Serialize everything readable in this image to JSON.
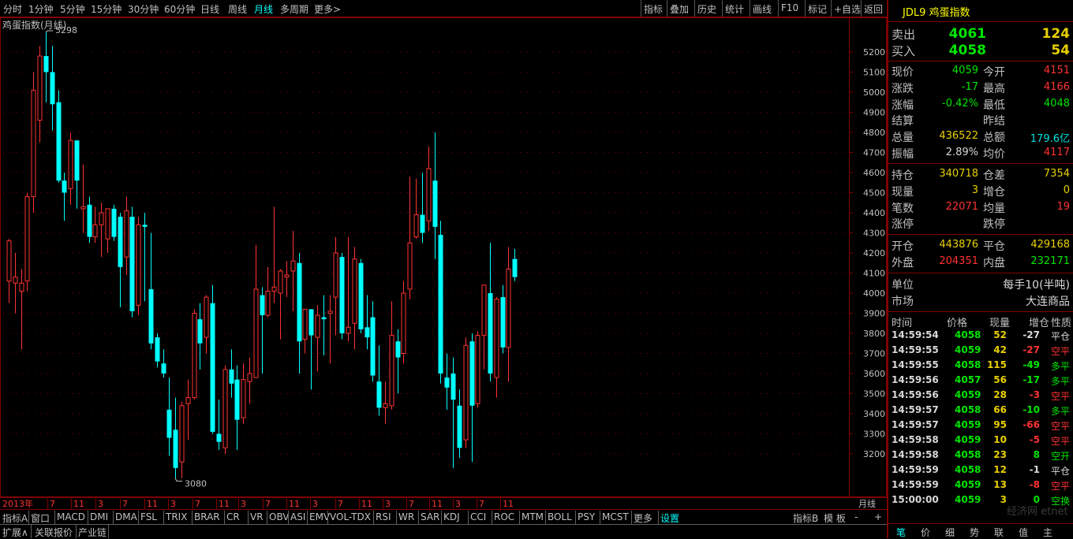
{
  "toolbar": {
    "periods": [
      "分时",
      "1分钟",
      "5分钟",
      "15分钟",
      "30分钟",
      "60分钟",
      "日线",
      "周线",
      "月线",
      "多周期",
      "更多>"
    ],
    "active_period": "月线",
    "right_items": [
      "指标",
      "叠加",
      "历史",
      "统计",
      "画线",
      "F10",
      "标记",
      "+自选",
      "返回"
    ]
  },
  "chart": {
    "title": "鸡蛋指数(月线)",
    "max_label": "5298",
    "min_label": "3080",
    "period_label": "月线",
    "year_label": "2013年",
    "x_ticks": [
      "7",
      "11",
      "3",
      "7",
      "11",
      "3",
      "7",
      "11",
      "3",
      "7",
      "11",
      "3",
      "7",
      "11",
      "3",
      "7",
      "11",
      "3",
      "7",
      "11"
    ],
    "colors": {
      "up": "#ff3232",
      "down": "#00ffff",
      "grid": "#800000",
      "axis_text": "#c0c0c0"
    }
  },
  "chart_data": {
    "type": "candlestick",
    "title": "鸡蛋指数(月线)",
    "y_ticks": [
      3200,
      3300,
      3400,
      3500,
      3600,
      3700,
      3800,
      3900,
      4000,
      4100,
      4200,
      4300,
      4400,
      4500,
      4600,
      4700,
      4800,
      4900,
      5000,
      5100,
      5200
    ],
    "ylim": [
      3080,
      5298
    ],
    "candles": [
      {
        "o": 4060,
        "h": 4270,
        "l": 3950,
        "c": 4260
      },
      {
        "o": 4050,
        "h": 4200,
        "l": 3900,
        "c": 4080
      },
      {
        "o": 4010,
        "h": 4120,
        "l": 3720,
        "c": 4050
      },
      {
        "o": 4060,
        "h": 4500,
        "l": 4010,
        "c": 4480
      },
      {
        "o": 4480,
        "h": 5100,
        "l": 4400,
        "c": 5010
      },
      {
        "o": 4860,
        "h": 5230,
        "l": 4750,
        "c": 5180
      },
      {
        "o": 5180,
        "h": 5298,
        "l": 4950,
        "c": 5100
      },
      {
        "o": 5100,
        "h": 5230,
        "l": 4810,
        "c": 4940
      },
      {
        "o": 4950,
        "h": 5010,
        "l": 4550,
        "c": 4560
      },
      {
        "o": 4560,
        "h": 4600,
        "l": 4360,
        "c": 4500
      },
      {
        "o": 4520,
        "h": 4800,
        "l": 4440,
        "c": 4760
      },
      {
        "o": 4760,
        "h": 4720,
        "l": 4420,
        "c": 4560
      },
      {
        "o": 4420,
        "h": 4640,
        "l": 4300,
        "c": 4430
      },
      {
        "o": 4440,
        "h": 4480,
        "l": 4250,
        "c": 4280
      },
      {
        "o": 4280,
        "h": 4430,
        "l": 4250,
        "c": 4340
      },
      {
        "o": 4340,
        "h": 4450,
        "l": 4180,
        "c": 4400
      },
      {
        "o": 4270,
        "h": 4410,
        "l": 4200,
        "c": 4420
      },
      {
        "o": 4420,
        "h": 4440,
        "l": 4260,
        "c": 4280
      },
      {
        "o": 4380,
        "h": 4400,
        "l": 3930,
        "c": 4130
      },
      {
        "o": 4180,
        "h": 4480,
        "l": 4090,
        "c": 4410
      },
      {
        "o": 4380,
        "h": 4430,
        "l": 3880,
        "c": 3910
      },
      {
        "o": 3940,
        "h": 4380,
        "l": 3890,
        "c": 4340
      },
      {
        "o": 4340,
        "h": 4400,
        "l": 3960,
        "c": 4330
      },
      {
        "o": 4020,
        "h": 4300,
        "l": 3720,
        "c": 3750
      },
      {
        "o": 3780,
        "h": 3800,
        "l": 3630,
        "c": 3660
      },
      {
        "o": 3650,
        "h": 3720,
        "l": 3580,
        "c": 3600
      },
      {
        "o": 3420,
        "h": 3580,
        "l": 3190,
        "c": 3280
      },
      {
        "o": 3320,
        "h": 3480,
        "l": 3080,
        "c": 3130
      },
      {
        "o": 3160,
        "h": 3460,
        "l": 3080,
        "c": 3440
      },
      {
        "o": 3450,
        "h": 3570,
        "l": 3270,
        "c": 3480
      },
      {
        "o": 3480,
        "h": 3920,
        "l": 3470,
        "c": 3900
      },
      {
        "o": 3870,
        "h": 3950,
        "l": 3620,
        "c": 3750
      },
      {
        "o": 3780,
        "h": 3990,
        "l": 3700,
        "c": 3980
      },
      {
        "o": 3950,
        "h": 4040,
        "l": 3300,
        "c": 3310
      },
      {
        "o": 3300,
        "h": 3470,
        "l": 3220,
        "c": 3260
      },
      {
        "o": 3230,
        "h": 3640,
        "l": 3200,
        "c": 3620
      },
      {
        "o": 3620,
        "h": 3720,
        "l": 3480,
        "c": 3550
      },
      {
        "o": 3570,
        "h": 3640,
        "l": 3220,
        "c": 3370
      },
      {
        "o": 3380,
        "h": 3650,
        "l": 3350,
        "c": 3570
      },
      {
        "o": 3560,
        "h": 3680,
        "l": 3450,
        "c": 3600
      },
      {
        "o": 3580,
        "h": 4240,
        "l": 3580,
        "c": 4020
      },
      {
        "o": 3990,
        "h": 4030,
        "l": 3600,
        "c": 3890
      },
      {
        "o": 3890,
        "h": 4130,
        "l": 3880,
        "c": 4010
      },
      {
        "o": 4010,
        "h": 4430,
        "l": 3950,
        "c": 4030
      },
      {
        "o": 4000,
        "h": 4120,
        "l": 3770,
        "c": 4110
      },
      {
        "o": 4080,
        "h": 4160,
        "l": 3980,
        "c": 4090
      },
      {
        "o": 4110,
        "h": 4310,
        "l": 3910,
        "c": 4160
      },
      {
        "o": 4150,
        "h": 4200,
        "l": 3600,
        "c": 3760
      },
      {
        "o": 3770,
        "h": 3900,
        "l": 3700,
        "c": 3920
      },
      {
        "o": 3920,
        "h": 3920,
        "l": 3520,
        "c": 3790
      },
      {
        "o": 3780,
        "h": 3940,
        "l": 3610,
        "c": 3890
      },
      {
        "o": 3880,
        "h": 3990,
        "l": 3690,
        "c": 3870
      },
      {
        "o": 3900,
        "h": 3990,
        "l": 3650,
        "c": 3910
      },
      {
        "o": 3980,
        "h": 4280,
        "l": 3790,
        "c": 4200
      },
      {
        "o": 4180,
        "h": 4200,
        "l": 3770,
        "c": 3800
      },
      {
        "o": 3800,
        "h": 4280,
        "l": 3760,
        "c": 3830
      },
      {
        "o": 3850,
        "h": 4230,
        "l": 3720,
        "c": 4170
      },
      {
        "o": 4150,
        "h": 4170,
        "l": 3800,
        "c": 3820
      },
      {
        "o": 3830,
        "h": 3990,
        "l": 3720,
        "c": 3780
      },
      {
        "o": 3880,
        "h": 3960,
        "l": 3560,
        "c": 3590
      },
      {
        "o": 3560,
        "h": 3740,
        "l": 3390,
        "c": 3430
      },
      {
        "o": 3430,
        "h": 3560,
        "l": 3350,
        "c": 3450
      },
      {
        "o": 3440,
        "h": 3960,
        "l": 3420,
        "c": 3790
      },
      {
        "o": 3760,
        "h": 3820,
        "l": 3500,
        "c": 3680
      },
      {
        "o": 3700,
        "h": 4060,
        "l": 3650,
        "c": 4000
      },
      {
        "o": 4020,
        "h": 4580,
        "l": 3970,
        "c": 4250
      },
      {
        "o": 4280,
        "h": 4570,
        "l": 4270,
        "c": 4390
      },
      {
        "o": 4390,
        "h": 4600,
        "l": 4250,
        "c": 4300
      },
      {
        "o": 4360,
        "h": 4730,
        "l": 4310,
        "c": 4620
      },
      {
        "o": 4560,
        "h": 4800,
        "l": 4170,
        "c": 4330
      },
      {
        "o": 4290,
        "h": 4360,
        "l": 3550,
        "c": 3600
      },
      {
        "o": 3580,
        "h": 3700,
        "l": 3420,
        "c": 3530
      },
      {
        "o": 3600,
        "h": 3680,
        "l": 3130,
        "c": 3470
      },
      {
        "o": 3440,
        "h": 3520,
        "l": 3180,
        "c": 3230
      },
      {
        "o": 3270,
        "h": 3780,
        "l": 3230,
        "c": 3740
      },
      {
        "o": 3760,
        "h": 3800,
        "l": 3160,
        "c": 3440
      },
      {
        "o": 3450,
        "h": 3810,
        "l": 3430,
        "c": 3790
      },
      {
        "o": 3790,
        "h": 4000,
        "l": 3620,
        "c": 4040
      },
      {
        "o": 4000,
        "h": 4250,
        "l": 3560,
        "c": 3600
      },
      {
        "o": 3580,
        "h": 3980,
        "l": 3480,
        "c": 3970
      },
      {
        "o": 3980,
        "h": 4040,
        "l": 3700,
        "c": 3730
      },
      {
        "o": 3730,
        "h": 4230,
        "l": 3560,
        "c": 4120
      },
      {
        "o": 4170,
        "h": 4220,
        "l": 4060,
        "c": 4080
      }
    ]
  },
  "panel": {
    "contract": "JDL9 鸡蛋指数",
    "ask_label": "卖出",
    "ask_price": "4061",
    "ask_vol": "124",
    "bid_label": "买入",
    "bid_price": "4058",
    "bid_vol": "54",
    "stats1": [
      {
        "l1": "现价",
        "v1": "4059",
        "c1": "green",
        "l2": "今开",
        "v2": "4151",
        "c2": "red"
      },
      {
        "l1": "涨跌",
        "v1": "-17",
        "c1": "green",
        "l2": "最高",
        "v2": "4166",
        "c2": "red"
      },
      {
        "l1": "涨幅",
        "v1": "-0.42%",
        "c1": "green",
        "l2": "最低",
        "v2": "4048",
        "c2": "green"
      },
      {
        "l1": "结算",
        "v1": "",
        "c1": "white",
        "l2": "昨结",
        "v2": "",
        "c2": "white"
      },
      {
        "l1": "总量",
        "v1": "436522",
        "c1": "yellow",
        "l2": "总额",
        "v2": "179.6亿",
        "c2": "cyan"
      },
      {
        "l1": "振幅",
        "v1": "2.89%",
        "c1": "white",
        "l2": "均价",
        "v2": "4117",
        "c2": "red"
      }
    ],
    "stats2": [
      {
        "l1": "持仓",
        "v1": "340718",
        "c1": "yellow",
        "l2": "仓差",
        "v2": "7354",
        "c2": "yellow"
      },
      {
        "l1": "现量",
        "v1": "3",
        "c1": "yellow",
        "l2": "增仓",
        "v2": "0",
        "c2": "yellow"
      },
      {
        "l1": "笔数",
        "v1": "22071",
        "c1": "red",
        "l2": "均量",
        "v2": "19",
        "c2": "red"
      },
      {
        "l1": "涨停",
        "v1": "",
        "c1": "white",
        "l2": "跌停",
        "v2": "",
        "c2": "white"
      }
    ],
    "stats3": [
      {
        "l1": "开仓",
        "v1": "443876",
        "c1": "yellow",
        "l2": "平仓",
        "v2": "429168",
        "c2": "yellow"
      },
      {
        "l1": "外盘",
        "v1": "204351",
        "c1": "red",
        "l2": "内盘",
        "v2": "232171",
        "c2": "green"
      }
    ],
    "unit_label": "单位",
    "unit_value": "每手10(半吨)",
    "market_label": "市场",
    "market_value": "大连商品",
    "tick_headers": [
      "时间",
      "价格",
      "现量",
      "增仓",
      "性质"
    ],
    "ticks": [
      {
        "t": "14:59:54",
        "p": "4058",
        "v": "52",
        "d": "-27",
        "n": "平仓",
        "pc": "green",
        "dc": "white",
        "nc": "white"
      },
      {
        "t": "14:59:55",
        "p": "4059",
        "v": "42",
        "d": "-27",
        "n": "空平",
        "pc": "green",
        "dc": "red",
        "nc": "red"
      },
      {
        "t": "14:59:55",
        "p": "4058",
        "v": "115",
        "d": "-49",
        "n": "多平",
        "pc": "green",
        "dc": "green",
        "nc": "green"
      },
      {
        "t": "14:59:56",
        "p": "4057",
        "v": "56",
        "d": "-17",
        "n": "多平",
        "pc": "green",
        "dc": "green",
        "nc": "green"
      },
      {
        "t": "14:59:56",
        "p": "4059",
        "v": "28",
        "d": "-3",
        "n": "空平",
        "pc": "green",
        "dc": "red",
        "nc": "red"
      },
      {
        "t": "14:59:57",
        "p": "4058",
        "v": "66",
        "d": "-10",
        "n": "多平",
        "pc": "green",
        "dc": "green",
        "nc": "green"
      },
      {
        "t": "14:59:57",
        "p": "4059",
        "v": "95",
        "d": "-66",
        "n": "空平",
        "pc": "green",
        "dc": "red",
        "nc": "red"
      },
      {
        "t": "14:59:58",
        "p": "4059",
        "v": "10",
        "d": "-5",
        "n": "空平",
        "pc": "green",
        "dc": "red",
        "nc": "red"
      },
      {
        "t": "14:59:58",
        "p": "4058",
        "v": "23",
        "d": "8",
        "n": "空开",
        "pc": "green",
        "dc": "green",
        "nc": "green"
      },
      {
        "t": "14:59:59",
        "p": "4058",
        "v": "12",
        "d": "-1",
        "n": "平仓",
        "pc": "green",
        "dc": "white",
        "nc": "white"
      },
      {
        "t": "14:59:59",
        "p": "4059",
        "v": "13",
        "d": "-8",
        "n": "空平",
        "pc": "green",
        "dc": "red",
        "nc": "red"
      },
      {
        "t": "15:00:00",
        "p": "4059",
        "v": "3",
        "d": "0",
        "n": "空换",
        "pc": "green",
        "dc": "green",
        "nc": "green"
      }
    ],
    "tabs": [
      "笔",
      "价",
      "细",
      "势",
      "联",
      "值",
      "主"
    ],
    "watermark": "经济网 etnet"
  },
  "indicators": [
    "指标A",
    "窗口",
    "MACD",
    "DMI",
    "DMA",
    "FSL",
    "TRIX",
    "BRAR",
    "CR",
    "VR",
    "OBV",
    "ASI",
    "EMV",
    "VOL-TDX",
    "RSI",
    "WR",
    "SAR",
    "KDJ",
    "CCI",
    "ROC",
    "MTM",
    "BOLL",
    "PSY",
    "MCST",
    "更多",
    "设置"
  ],
  "indicator_active": "设置",
  "indicator_right": [
    "指标B",
    "模 板",
    "-",
    "+"
  ],
  "bottom_items": [
    "扩展∧",
    "关联报价",
    "产业链"
  ]
}
